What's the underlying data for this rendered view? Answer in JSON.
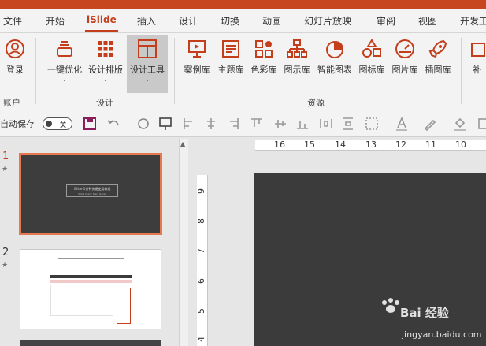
{
  "tabs": [
    "文件",
    "开始",
    "iSlide",
    "插入",
    "设计",
    "切换",
    "动画",
    "幻灯片放映",
    "审阅",
    "视图",
    "开发工"
  ],
  "ribbon": {
    "account": {
      "login": "登录",
      "group": "账户"
    },
    "design": {
      "one_click": "一键优化",
      "layout": "设计排版",
      "tools": "设计工具",
      "group": "设计"
    },
    "resources": {
      "cases": "案例库",
      "themes": "主题库",
      "colors": "色彩库",
      "diagrams": "图示库",
      "smart_charts": "智能图表",
      "icons": "图标库",
      "pictures": "图片库",
      "illustrations": "插图库",
      "group": "资源"
    },
    "more": "补"
  },
  "qat": {
    "autosave": "自动保存",
    "toggle_state": "关"
  },
  "slides": [
    {
      "number": "1",
      "star": "★",
      "title": "iSlide 1分钟快速使用教程",
      "subtitle": "iSlide Quick Start Guide"
    },
    {
      "number": "2",
      "star": "★"
    }
  ],
  "ruler": {
    "horizontal": [
      "16",
      "15",
      "14",
      "13",
      "12",
      "11",
      "10"
    ],
    "vertical": [
      "9",
      "8",
      "7",
      "6",
      "5",
      "4"
    ]
  },
  "watermark": {
    "brand": "Bai 经验",
    "url": "jingyan.baidu.com"
  },
  "colors": {
    "accent": "#c43e1c",
    "slide_bg": "#3b3b3b"
  }
}
